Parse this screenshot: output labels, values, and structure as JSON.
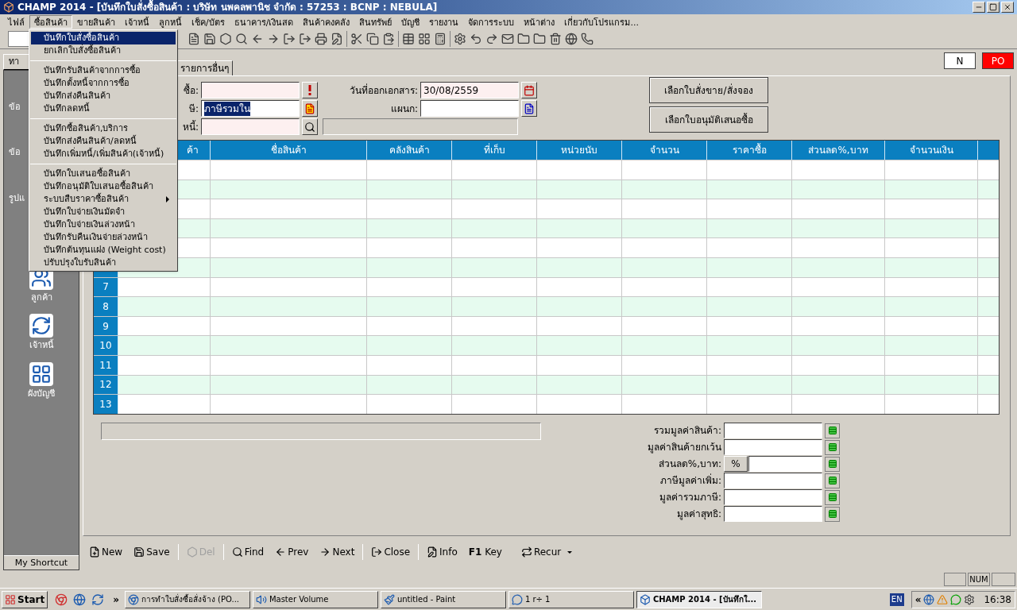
{
  "window": {
    "title": "CHAMP 2014 - [บันทึกใบสั่งซื้อสินค้า : บริษัท นพคลพานิช จำกัด : 57253 : BCNP : NEBULA]"
  },
  "menu_bar": [
    {
      "label": "ไฟล์",
      "selected": false
    },
    {
      "label": "ซื้อสินค้า",
      "selected": true
    },
    {
      "label": "ขายสินค้า",
      "selected": false
    },
    {
      "label": "เจ้าหนี้",
      "selected": false
    },
    {
      "label": "ลูกหนี้",
      "selected": false
    },
    {
      "label": "เช็ค/บัตร",
      "selected": false
    },
    {
      "label": "ธนาคาร/เงินสด",
      "selected": false
    },
    {
      "label": "สินค้าคงคลัง",
      "selected": false
    },
    {
      "label": "สินทรัพย์",
      "selected": false
    },
    {
      "label": "บัญชี",
      "selected": false
    },
    {
      "label": "รายงาน",
      "selected": false
    },
    {
      "label": "จัดการระบบ",
      "selected": false
    },
    {
      "label": "หน้าต่าง",
      "selected": false
    },
    {
      "label": "เกี่ยวกับโปรแกรม...",
      "selected": false
    }
  ],
  "dropdown": [
    {
      "kind": "item",
      "label": "บันทึกใบสั่งซื้อสินค้า",
      "selected": true,
      "submenu": false
    },
    {
      "kind": "item",
      "label": "ยกเลิกใบสั่งซื้อสินค้า",
      "selected": false,
      "submenu": false
    },
    {
      "kind": "separator"
    },
    {
      "kind": "item",
      "label": "บันทึกรับสินค้าจากการซื้อ",
      "selected": false,
      "submenu": false
    },
    {
      "kind": "item",
      "label": "บันทึกตั้งหนี้จากการซื้อ",
      "selected": false,
      "submenu": false
    },
    {
      "kind": "item",
      "label": "บันทึกส่งคืนสินค้า",
      "selected": false,
      "submenu": false
    },
    {
      "kind": "item",
      "label": "บันทึกลดหนี้",
      "selected": false,
      "submenu": false
    },
    {
      "kind": "separator"
    },
    {
      "kind": "item",
      "label": "บันทึกซื้อสินค้า,บริการ",
      "selected": false,
      "submenu": false
    },
    {
      "kind": "item",
      "label": "บันทึกส่งคืนสินค้า/ลดหนี้",
      "selected": false,
      "submenu": false
    },
    {
      "kind": "item",
      "label": "บันทึกเพิ่มหนี้/เพิ่มสินค้า(เจ้าหนี้)",
      "selected": false,
      "submenu": false
    },
    {
      "kind": "separator"
    },
    {
      "kind": "item",
      "label": "บันทึกใบเสนอซื้อสินค้า",
      "selected": false,
      "submenu": false
    },
    {
      "kind": "item",
      "label": "บันทึกอนุมัติใบเสนอซื้อสินค้า",
      "selected": false,
      "submenu": false
    },
    {
      "kind": "item",
      "label": "ระบบสืบราคาซื้อสินค้า",
      "selected": false,
      "submenu": true
    },
    {
      "kind": "item",
      "label": "บันทึกใบจ่ายเงินมัดจำ",
      "selected": false,
      "submenu": false
    },
    {
      "kind": "item",
      "label": "บันทึกใบจ่ายเงินล่วงหน้า",
      "selected": false,
      "submenu": false
    },
    {
      "kind": "item",
      "label": "บันทึกรับคืนเงินจ่ายล่วงหน้า",
      "selected": false,
      "submenu": false
    },
    {
      "kind": "item",
      "label": "บันทึกต้นทุนแฝง (Weight cost)",
      "selected": false,
      "submenu": false
    },
    {
      "kind": "item",
      "label": "ปรับปรุงใบรับสินค้า",
      "selected": false,
      "submenu": false
    }
  ],
  "shortcut_panel": {
    "tab": "ทา",
    "items": [
      {
        "label": "ข้อ",
        "kind": "text"
      },
      {
        "label": "ข้อ",
        "kind": "text"
      },
      {
        "label": "รูปแ",
        "kind": "text"
      },
      {
        "label": "ลูกค้า",
        "kind": "customers"
      },
      {
        "label": "เจ้าหนี้",
        "kind": "creditors"
      },
      {
        "label": "ผังบัญชี",
        "kind": "chart"
      }
    ],
    "footer": "My Shortcut"
  },
  "tabs": [
    {
      "label": "รายการอื่นๆ",
      "selected": false
    }
  ],
  "doc_badges": [
    {
      "text": "N",
      "kind": "plain"
    },
    {
      "text": "PO",
      "kind": "alert"
    }
  ],
  "left_fields": [
    {
      "label": "ซื้อ:",
      "tinted": true
    },
    {
      "label": "ษี:",
      "value": "ภาษีรวมใน",
      "tinted": false,
      "highlighted": true
    },
    {
      "label": "หนี้:",
      "tinted": true
    }
  ],
  "right_fields": [
    {
      "label": "วันที่ออกเอกสาร:",
      "value": "30/08/2559",
      "tinted": true
    },
    {
      "label": "แผนก:",
      "tinted": false
    }
  ],
  "action_buttons": [
    "เลือกใบสั่งขาย/สั่งจอง",
    "เลือกใบอนุมัติเสนอซื้อ"
  ],
  "grid": {
    "columns": [
      "ค้า",
      "ชื่อสินค้า",
      "คลังสินค้า",
      "ที่เก็บ",
      "หน่วยนับ",
      "จำนวน",
      "ราคาซื้อ",
      "ส่วนลด%,บาท",
      "จำนวนเงิน"
    ],
    "rows": [
      {
        "striped": false
      },
      {
        "striped": true
      },
      {
        "striped": false
      },
      {
        "striped": true
      },
      {
        "striped": false
      },
      {
        "striped": true
      },
      {
        "number": "7",
        "striped": false
      },
      {
        "number": "8",
        "striped": true
      },
      {
        "number": "9",
        "striped": false
      },
      {
        "number": "10",
        "striped": true
      },
      {
        "number": "11",
        "striped": false
      },
      {
        "number": "12",
        "striped": true
      },
      {
        "number": "13",
        "striped": false
      }
    ]
  },
  "totals": [
    {
      "label": "รวมมูลค่าสินค้า:",
      "kind": "field"
    },
    {
      "label": "มูลค่าสินค้ายกเว้น",
      "kind": "field"
    },
    {
      "label": "ส่วนลด%,บาท:",
      "kind": "percent",
      "button": "%"
    },
    {
      "label": "ภาษีมูลค่าเพิ่ม:",
      "kind": "field"
    },
    {
      "label": "มูลค่ารวมภาษี:",
      "kind": "field"
    },
    {
      "label": "มูลค่าสุทธิ:",
      "kind": "field"
    }
  ],
  "bottom_toolbar": [
    {
      "label": "New",
      "kind": "button",
      "disabled": false
    },
    {
      "label": "Save",
      "kind": "button",
      "disabled": false
    },
    {
      "label": "Del",
      "kind": "button",
      "disabled": true
    },
    {
      "label": "Find",
      "kind": "button",
      "disabled": false
    },
    {
      "label": "Prev",
      "kind": "button",
      "disabled": false
    },
    {
      "label": "Next",
      "kind": "button",
      "disabled": false
    },
    {
      "label": "Close",
      "kind": "button",
      "disabled": false
    },
    {
      "label": "Info",
      "kind": "button",
      "disabled": false
    },
    {
      "label": "**F1** Key",
      "kind": "key",
      "disabled": false
    },
    {
      "label": "Recur",
      "kind": "dropdown",
      "disabled": false
    }
  ],
  "status_bar": {
    "num": "NUM"
  },
  "taskbar": {
    "start": "Start",
    "more": "»",
    "tasks": [
      {
        "label": "การทำใบสั่งซื้อสั่งจ้าง (PO...",
        "selected": false,
        "kind": "browser"
      },
      {
        "label": "Master Volume",
        "selected": false,
        "kind": "volume"
      },
      {
        "label": "untitled - Paint",
        "selected": false,
        "kind": "paint"
      },
      {
        "label": "1 r÷ 1",
        "selected": false,
        "kind": "chat"
      },
      {
        "label": "CHAMP 2014 - [บันทึกใ...",
        "selected": true,
        "kind": "app"
      }
    ],
    "language": "EN",
    "tray_expand": "«",
    "clock": "16:38"
  }
}
